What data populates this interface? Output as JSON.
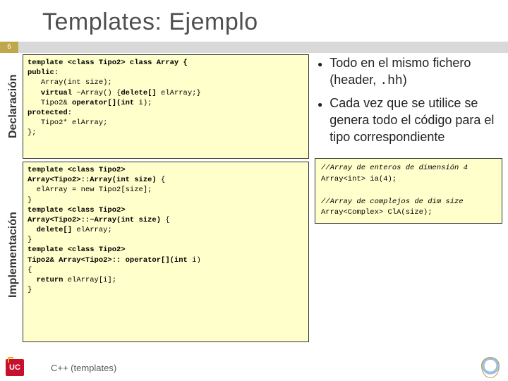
{
  "title": "Templates: Ejemplo",
  "page_number": "6",
  "labels": {
    "declaration": "Declaración",
    "implementation": "Implementación"
  },
  "code": {
    "decl_html": "<span class=\"kw\">template &lt;class Tipo2&gt; class Array {</span>\n<span class=\"kw\">public:</span>\n   Array(int size);\n   <span class=\"kw\">virtual</span> ~Array() {<span class=\"kw\">delete[]</span> elArray;}\n   Tipo2&amp; <span class=\"kw\">operator[](int</span> i);\n<span class=\"kw\">protected:</span>\n   Tipo2* elArray;\n};",
    "impl_html": "<span class=\"kw\">template &lt;class Tipo2&gt;</span>\n<span class=\"kw\">Array&lt;Tipo2&gt;::Array(int size)</span> {\n  elArray = new Tipo2[size];\n}\n<span class=\"kw\">template &lt;class Tipo2&gt;</span>\n<span class=\"kw\">Array&lt;Tipo2&gt;::~Array(int size)</span> {\n  <span class=\"kw\">delete[]</span> elArray;\n}\n<span class=\"kw\">template &lt;class Tipo2&gt;</span>\n<span class=\"kw\">Tipo2&amp; Array&lt;Tipo2&gt;:: operator[](int</span> i)\n{\n  <span class=\"kw\">return</span> elArray[i];\n}"
  },
  "bullets": [
    {
      "text": "Todo en el mismo fichero (header, ",
      "tail_mono": ".hh",
      "tail": ")"
    },
    {
      "text": "Cada vez que se utilice se genera todo el código para el tipo correspondiente"
    }
  ],
  "usage_html": "//Array de enteros de dimensión 4\n<span class=\"noit\">Array&lt;int&gt; ia(4);</span>\n\n//Array de complejos de dim size\n<span class=\"noit\">Array&lt;Complex&gt; ClA(size);</span>",
  "footer": {
    "logo_text": "UC",
    "caption": "C++ (templates)"
  }
}
